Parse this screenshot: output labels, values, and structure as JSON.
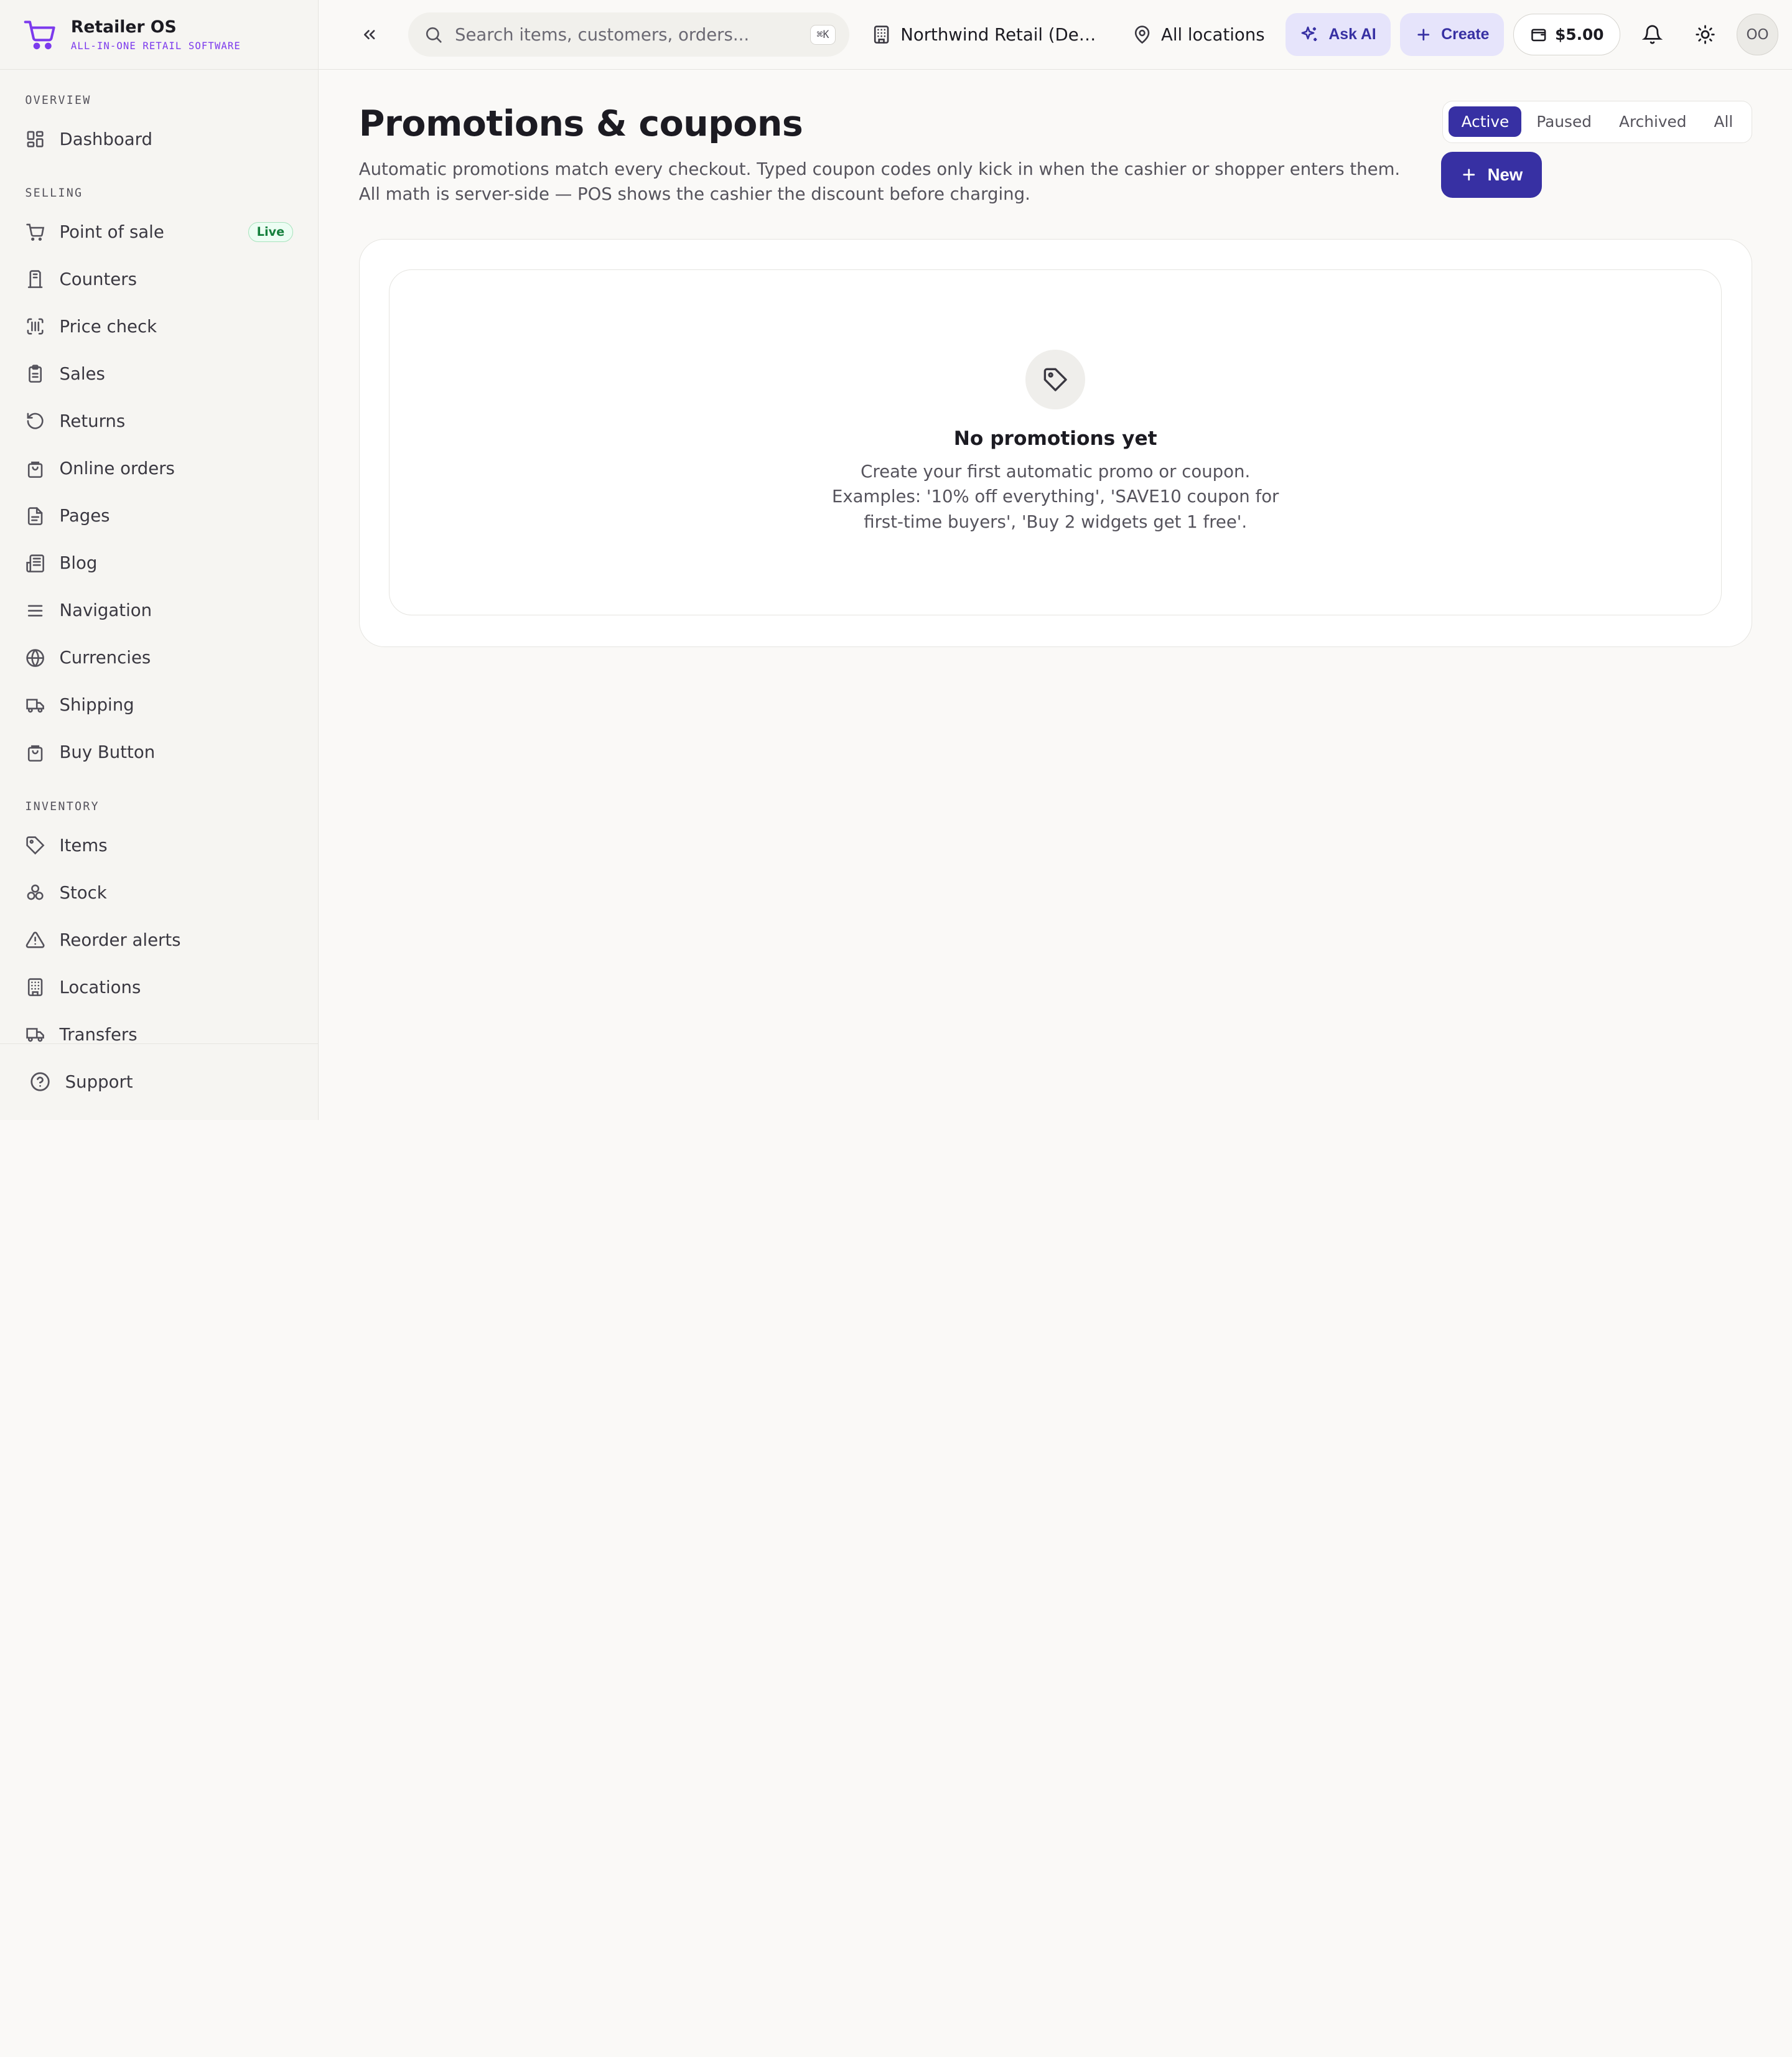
{
  "brand": {
    "name": "Retailer OS",
    "tagline": "ALL-IN-ONE RETAIL SOFTWARE"
  },
  "sidebar": {
    "sections": [
      {
        "label": "OVERVIEW",
        "items": [
          {
            "label": "Dashboard",
            "icon": "dashboard-icon"
          }
        ]
      },
      {
        "label": "SELLING",
        "items": [
          {
            "label": "Point of sale",
            "icon": "cart-icon",
            "badge": "Live"
          },
          {
            "label": "Counters",
            "icon": "counter-icon"
          },
          {
            "label": "Price check",
            "icon": "barcode-icon"
          },
          {
            "label": "Sales",
            "icon": "clipboard-icon"
          },
          {
            "label": "Returns",
            "icon": "return-icon"
          },
          {
            "label": "Online orders",
            "icon": "shopping-bag-icon"
          },
          {
            "label": "Pages",
            "icon": "file-icon"
          },
          {
            "label": "Blog",
            "icon": "newspaper-icon"
          },
          {
            "label": "Navigation",
            "icon": "menu-icon"
          },
          {
            "label": "Currencies",
            "icon": "globe-icon"
          },
          {
            "label": "Shipping",
            "icon": "truck-icon"
          },
          {
            "label": "Buy Button",
            "icon": "shopping-bag-icon"
          }
        ]
      },
      {
        "label": "INVENTORY",
        "items": [
          {
            "label": "Items",
            "icon": "tag-icon"
          },
          {
            "label": "Stock",
            "icon": "boxes-icon"
          },
          {
            "label": "Reorder alerts",
            "icon": "alert-icon"
          },
          {
            "label": "Locations",
            "icon": "building-icon"
          },
          {
            "label": "Transfers",
            "icon": "truck-icon"
          }
        ]
      }
    ],
    "support": "Support"
  },
  "topbar": {
    "search_placeholder": "Search items, customers, orders...",
    "shortcut": "⌘K",
    "org": "Northwind Retail (Demo)",
    "location": "All locations",
    "ask_ai": "Ask AI",
    "create": "Create",
    "balance": "$5.00",
    "avatar": "OO"
  },
  "page": {
    "title": "Promotions & coupons",
    "description": "Automatic promotions match every checkout. Typed coupon codes only kick in when the cashier or shopper enters them. All math is server-side — POS shows the cashier the discount before charging.",
    "filters": [
      "Active",
      "Paused",
      "Archived",
      "All"
    ],
    "active_filter": "Active",
    "new_button": "New"
  },
  "empty_state": {
    "title": "No promotions yet",
    "text": "Create your first automatic promo or coupon. Examples: '10% off everything', 'SAVE10 coupon for first-time buyers', 'Buy 2 widgets get 1 free'."
  },
  "colors": {
    "accent": "#3730a3",
    "brand_purple": "#7c3aed",
    "live_green": "#15803d"
  }
}
